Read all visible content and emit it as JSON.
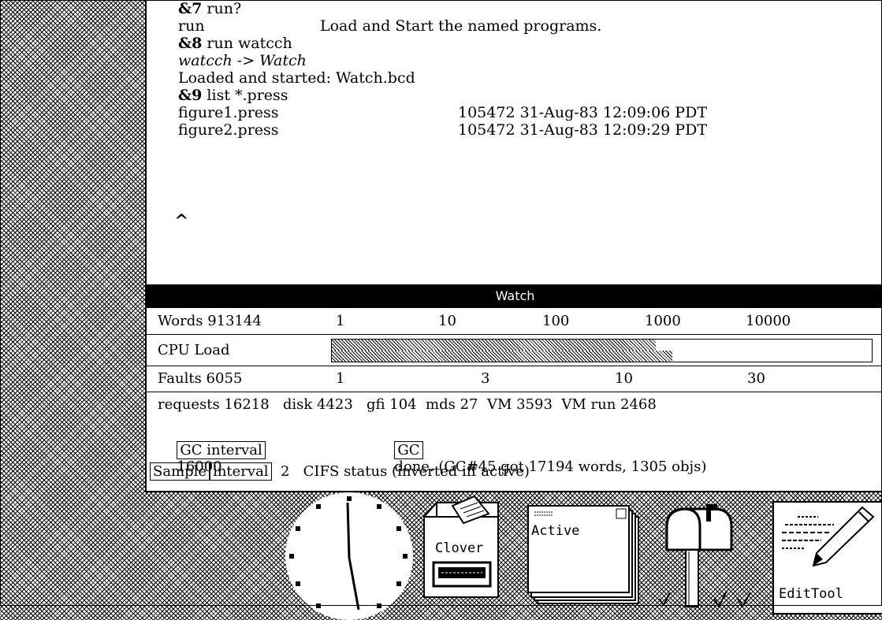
{
  "exec": {
    "lines": [
      {
        "prompt": "&7",
        "text": " run?"
      },
      {
        "text": "run",
        "desc": "Load and Start the named programs."
      },
      {
        "prompt": "&8",
        "text": " run watcch"
      },
      {
        "italic": "watcch -> Watch"
      },
      {
        "text": "Loaded and started: Watch.bcd"
      },
      {
        "prompt": "&9",
        "text": " list *.press"
      },
      {
        "file": "figure1.press",
        "info": "105472 31-Aug-83 12:09:06 PDT"
      },
      {
        "file": "figure2.press",
        "info": "105472 31-Aug-83 12:09:29 PDT"
      }
    ],
    "caret": "^"
  },
  "watch": {
    "title": "Watch",
    "words_label": "Words 913144",
    "words_scale": [
      "1",
      "10",
      "100",
      "1000",
      "10000"
    ],
    "cpu_label": "CPU Load",
    "cpu_load_fraction_top": 0.6,
    "cpu_load_fraction_bottom": 0.63,
    "faults_label": "Faults 6055",
    "faults_scale": [
      "1",
      "3",
      "10",
      "30"
    ],
    "requests_line": "requests 16218   disk 4423   gfi 104  mds 27  VM 3593  VM run 2468",
    "gc_interval_btn": "GC interval",
    "gc_interval_value": "16000",
    "gc_btn": "GC",
    "gc_status": "done. (GC#45 got 17194 words, 1305 objs)",
    "sample_btn": "Sample",
    "interval_btn": "interval",
    "interval_value": "2",
    "cifs_status": "CIFS status (inverted iff active)"
  },
  "icons": {
    "clover_label": "Clover",
    "active_label": "Active",
    "edittool_label": "EditTool"
  }
}
